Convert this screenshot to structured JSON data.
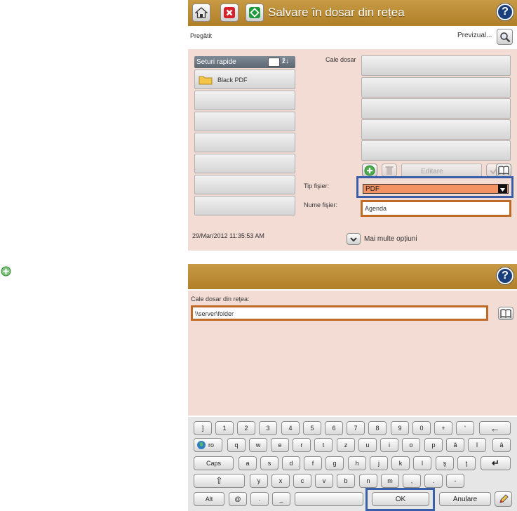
{
  "top": {
    "title": "Salvare în dosar din rețea",
    "status": "Pregătit",
    "preview_label": "Previzual...",
    "quick_sets_header": "Seturi rapide",
    "quick_sets_sort": "ẑ↓",
    "quick_sets": [
      "Black PDF",
      "",
      "",
      "",
      "",
      "",
      ""
    ],
    "folder_path_label": "Cale dosar",
    "folder_paths": [
      "",
      "",
      "",
      "",
      ""
    ],
    "edit_label": "Editare",
    "file_type_label": "Tip fişier:",
    "file_type_value": "PDF",
    "file_name_label": "Nume fişier:",
    "file_name_value": "Agenda",
    "datetime": "29/Mar/2012 11:35:53 AM",
    "more_options_label": "Mai multe opţiuni"
  },
  "bottom": {
    "path_label": "Cale dosar din reţea:",
    "path_value": "\\\\server\\folder",
    "rows": [
      [
        "]",
        "1",
        "2",
        "3",
        "4",
        "5",
        "6",
        "7",
        "8",
        "9",
        "0",
        "+",
        "'",
        "←"
      ],
      [
        "ro",
        "q",
        "w",
        "e",
        "r",
        "t",
        "z",
        "u",
        "i",
        "o",
        "p",
        "ă",
        "î",
        "â"
      ],
      [
        "Caps",
        "a",
        "s",
        "d",
        "f",
        "g",
        "h",
        "j",
        "k",
        "l",
        "ş",
        "ţ",
        "↵"
      ],
      [
        "⇧",
        "y",
        "x",
        "c",
        "v",
        "b",
        "n",
        "m",
        ",",
        ".",
        "-"
      ],
      [
        "Alt",
        "@",
        ".",
        "_",
        "",
        "OK",
        "Anulare"
      ]
    ]
  },
  "colors": {
    "header": "#b88a35",
    "panel": "#f3dcd3",
    "highlight_blue": "#3a5fa8",
    "highlight_orange": "#c06a28",
    "pdf_fill": "#f39262"
  },
  "icons": [
    "home-icon",
    "stop-icon",
    "start-icon",
    "help-icon",
    "magnifier-icon",
    "folder-icon",
    "add-icon",
    "trash-icon",
    "check-icon",
    "book-icon",
    "chevron-down-icon",
    "globe-icon",
    "pencil-icon"
  ]
}
